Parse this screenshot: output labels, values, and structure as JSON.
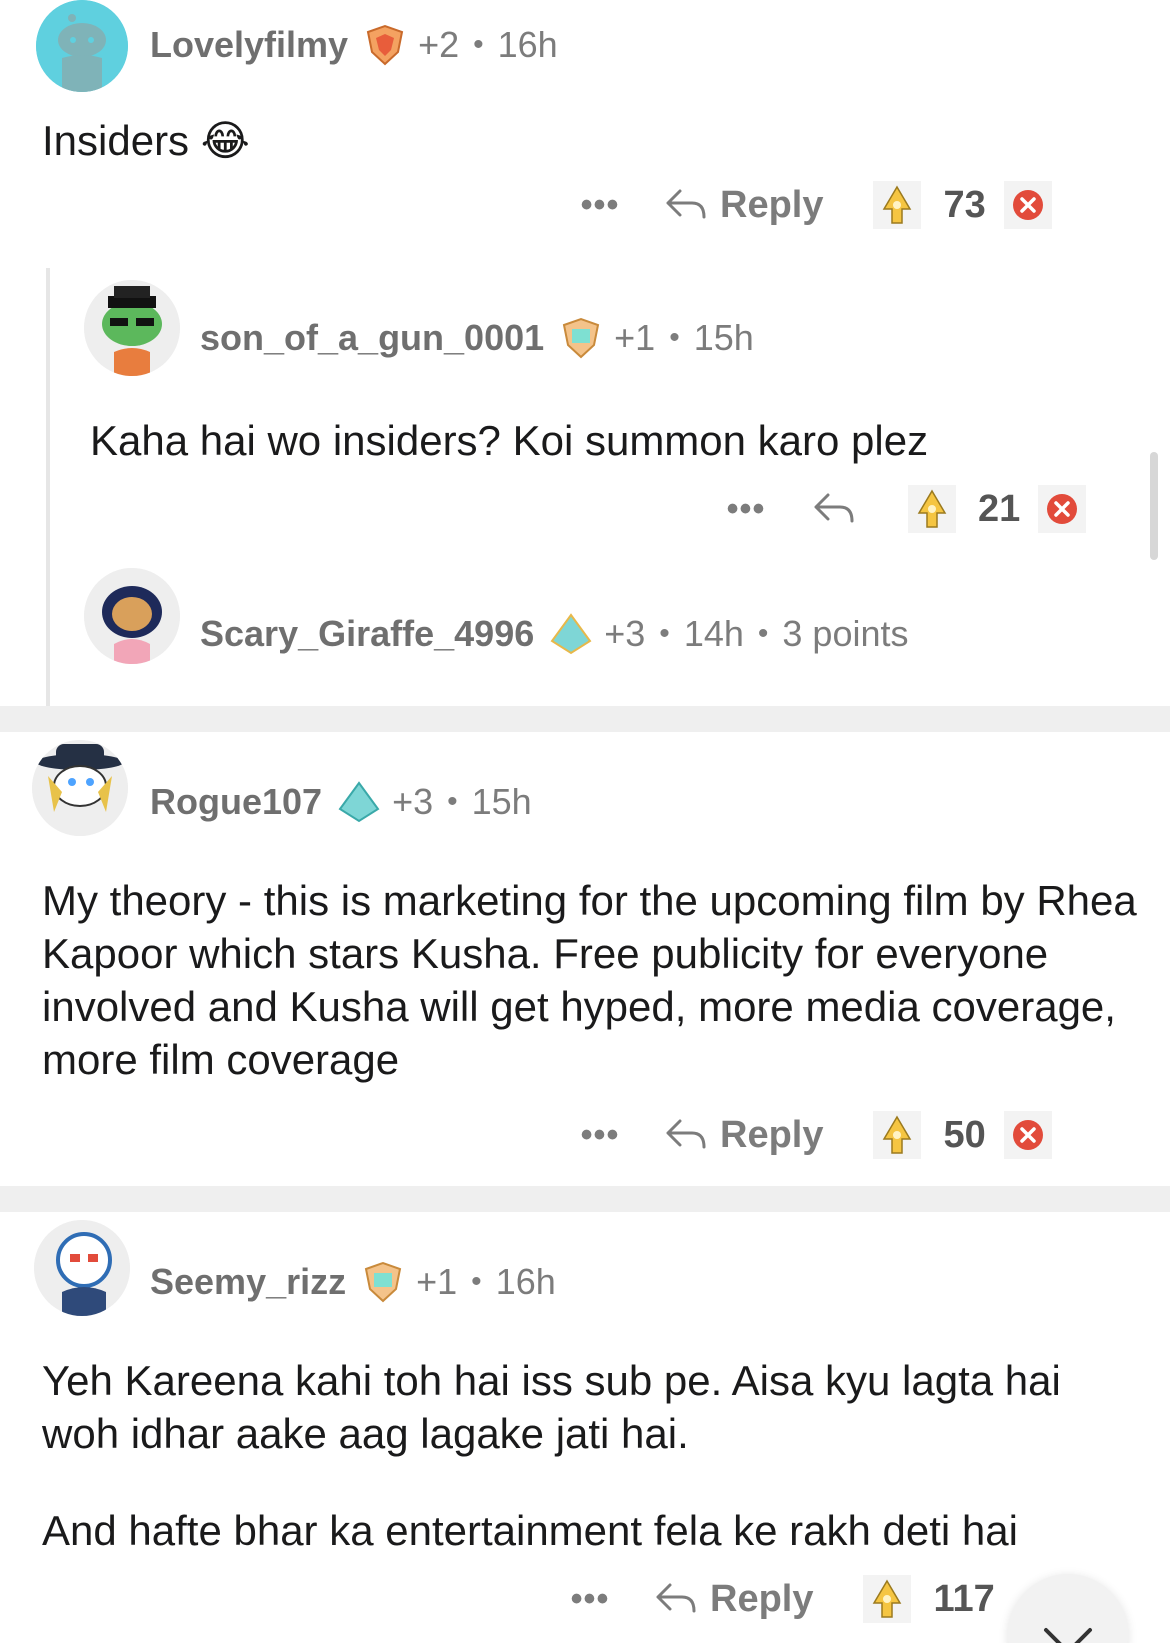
{
  "comments": [
    {
      "username": "Lovelyfilmy",
      "karma_delta": "+2",
      "age": "16h",
      "body": "Insiders 😂",
      "reply_label": "Reply",
      "score": "73"
    },
    {
      "username": "son_of_a_gun_0001",
      "karma_delta": "+1",
      "age": "15h",
      "body": "Kaha hai wo insiders? Koi summon karo plez",
      "score": "21"
    },
    {
      "username": "Scary_Giraffe_4996",
      "karma_delta": "+3",
      "age": "14h",
      "points": "3 points"
    },
    {
      "username": "Rogue107",
      "karma_delta": "+3",
      "age": "15h",
      "body": "My theory - this is marketing for the upcoming film by Rhea Kapoor which stars Kusha. Free publicity for everyone involved and Kusha will get hyped, more media coverage, more film coverage",
      "reply_label": "Reply",
      "score": "50"
    },
    {
      "username": "Seemy_rizz",
      "karma_delta": "+1",
      "age": "16h",
      "body_p1": "Yeh Kareena kahi toh hai iss sub pe.  Aisa kyu lagta hai woh idhar aake aag lagake jati hai.",
      "body_p2": "And hafte bhar ka entertainment fela ke rakh deti hai",
      "reply_label": "Reply",
      "score": "117"
    }
  ],
  "more_label": "•••",
  "separator": "•",
  "colors": {
    "accent_gold": "#f5c542",
    "downvote_red": "#e24b3b",
    "meta_gray": "#7c7c7c"
  },
  "icons": [
    "reply-arrow-icon",
    "upvote-award-icon",
    "downvote-x-icon",
    "chevron-down-icon"
  ]
}
